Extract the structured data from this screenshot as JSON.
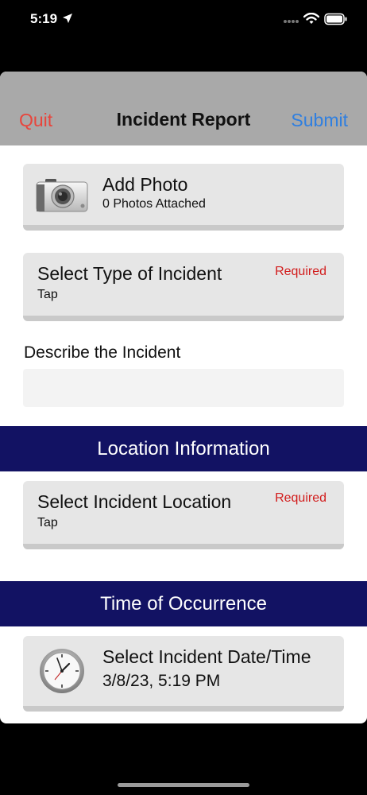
{
  "status_bar": {
    "time": "5:19",
    "icons": [
      "location-arrow-icon",
      "signal-dots-icon",
      "wifi-icon",
      "battery-icon"
    ]
  },
  "nav": {
    "left_label": "Quit",
    "title": "Incident Report",
    "right_label": "Submit"
  },
  "photo_card": {
    "title": "Add Photo",
    "subtitle": "0 Photos Attached",
    "icon": "camera-icon"
  },
  "type_card": {
    "title": "Select Type of Incident",
    "subtitle": "Tap",
    "badge": "Required"
  },
  "describe": {
    "label": "Describe the Incident",
    "value": ""
  },
  "location_section": {
    "header": "Location Information",
    "card": {
      "title": "Select Incident Location",
      "subtitle": "Tap",
      "badge": "Required"
    }
  },
  "time_section": {
    "header": "Time of Occurrence",
    "card": {
      "title": "Select Incident Date/Time",
      "value": "3/8/23, 5:19 PM",
      "icon": "clock-icon"
    }
  },
  "colors": {
    "nav_bar": "#a9a9a9",
    "quit": "#e8453c",
    "submit": "#2f7fe0",
    "required": "#d21c1c",
    "section_header": "#121263",
    "card": "#e6e6e6"
  }
}
